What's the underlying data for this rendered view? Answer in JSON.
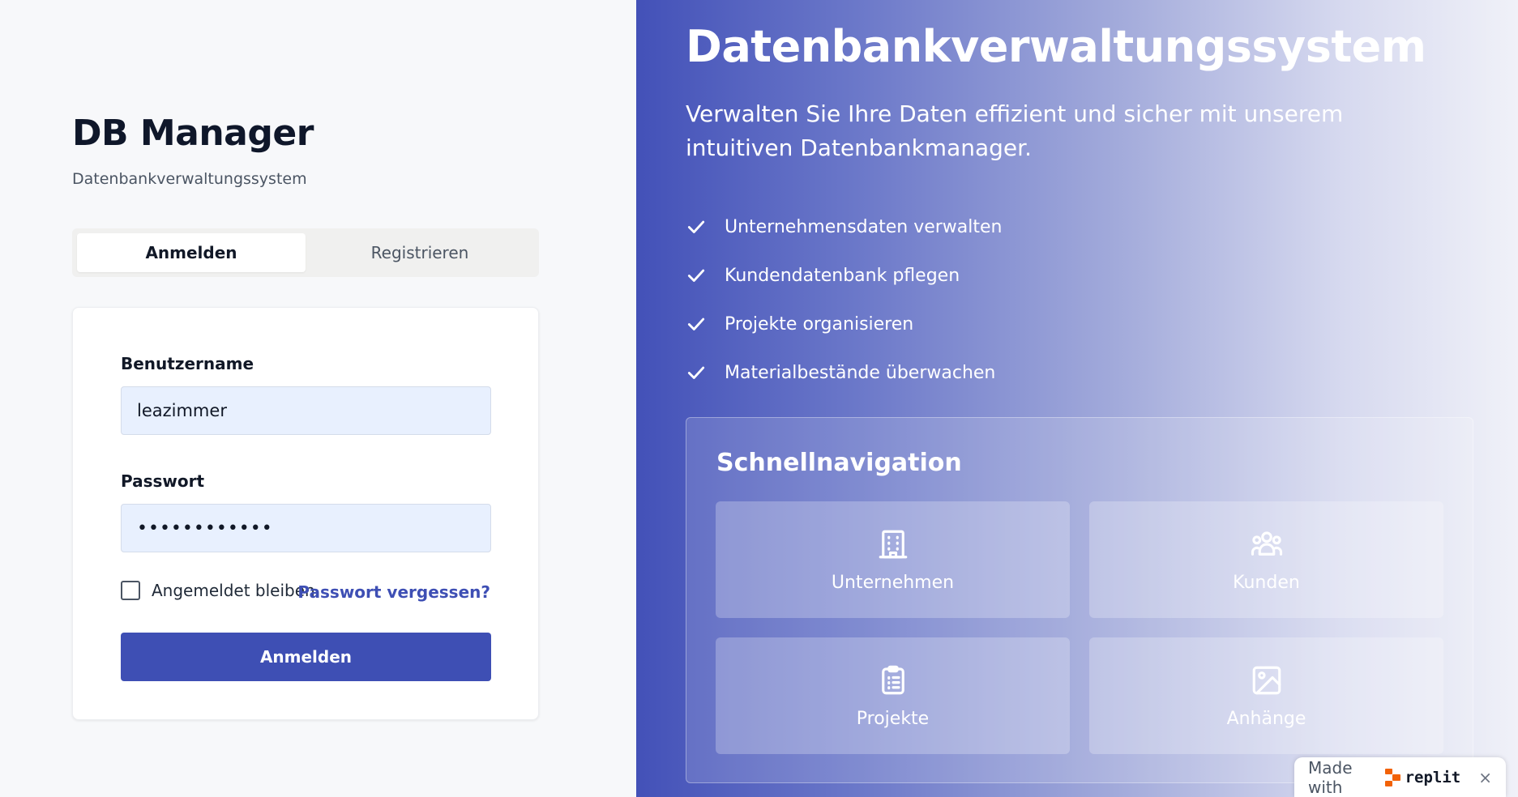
{
  "brand": {
    "title": "DB Manager",
    "subtitle": "Datenbankverwaltungssystem"
  },
  "tabs": [
    {
      "label": "Anmelden",
      "active": true
    },
    {
      "label": "Registrieren",
      "active": false
    }
  ],
  "login": {
    "username_label": "Benutzername",
    "username_value": "leazimmer",
    "password_label": "Passwort",
    "password_masked": "••••••••••••",
    "remember_label": "Angemeldet bleiben",
    "remember_checked": false,
    "forgot_label": "Passwort vergessen?",
    "submit_label": "Anmelden"
  },
  "hero": {
    "title": "Datenbankverwaltungssystem",
    "subtitle": "Verwalten Sie Ihre Daten effizient und sicher mit unserem intuitiven Datenbankmanager.",
    "features": [
      "Unternehmensdaten verwalten",
      "Kundendatenbank pflegen",
      "Projekte organisieren",
      "Materialbestände überwachen"
    ]
  },
  "quicknav": {
    "title": "Schnellnavigation",
    "tiles": [
      {
        "label": "Unternehmen",
        "icon": "building-icon"
      },
      {
        "label": "Kunden",
        "icon": "users-icon"
      },
      {
        "label": "Projekte",
        "icon": "clipboard-icon"
      },
      {
        "label": "Anhänge",
        "icon": "image-icon"
      }
    ]
  },
  "badge": {
    "text": "Made with",
    "logo_text": "replit",
    "close": "×"
  },
  "colors": {
    "primary": "#3e4fb4",
    "input_bg": "#e8f0fe",
    "panel_gradient_start": "#4351b8"
  }
}
